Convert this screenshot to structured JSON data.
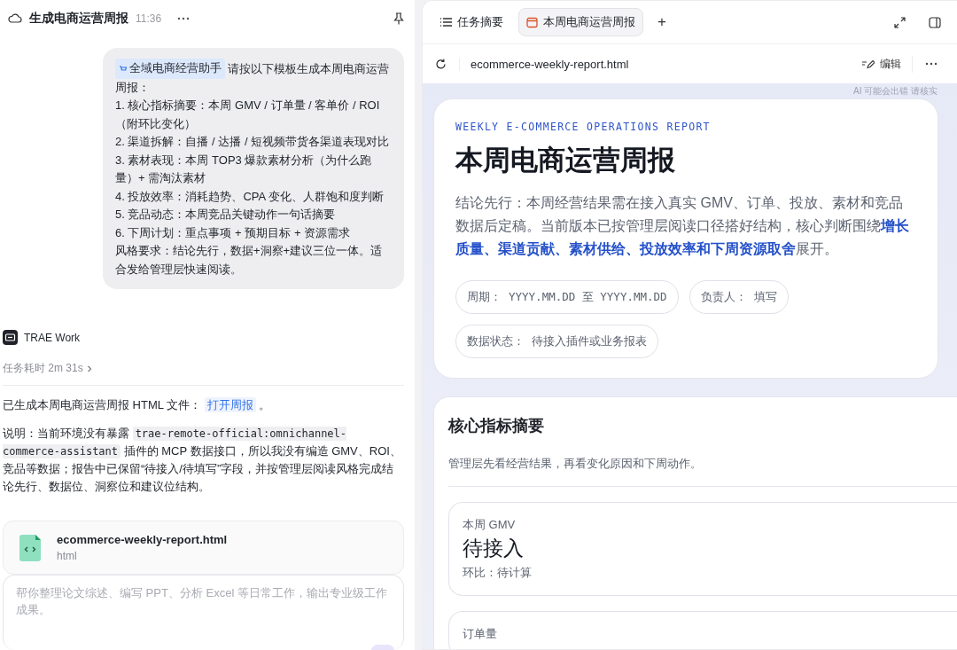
{
  "conversation": {
    "title": "生成电商运营周报",
    "time": "11:36"
  },
  "user_message": {
    "assistant_chip": "全域电商经营助手",
    "lines": [
      "请按以下模板生成本周电商运营周报：",
      "1. 核心指标摘要：本周 GMV / 订单量 / 客单价 / ROI（附环比变化）",
      "2. 渠道拆解：自播 / 达播 / 短视频带货各渠道表现对比",
      "3. 素材表现：本周 TOP3 爆款素材分析（为什么跑量）+ 需淘汰素材",
      "4. 投放效率：消耗趋势、CPA 变化、人群饱和度判断",
      "5. 竞品动态：本周竞品关键动作一句话摘要",
      "6. 下周计划：重点事项 + 预期目标 + 资源需求",
      "风格要求：结论先行，数据+洞察+建议三位一体。适合发给管理层快速阅读。"
    ]
  },
  "agent": {
    "name": "TRAE Work",
    "duration": "任务耗时 2m 31s"
  },
  "reply": {
    "generated_text": "已生成本周电商运营周报 HTML 文件：",
    "link": "打开周报",
    "generated_end": "。",
    "note_before": "说明：当前环境没有暴露 ",
    "note_code": "trae-remote-official:omnichannel-commerce-assistant",
    "note_after": " 插件的 MCP 数据接口，所以我没有编造 GMV、ROI、竞品等数据；报告中已保留“待接入/待填写”字段，并按管理层阅读风格完成结论先行、数据位、洞察位和建议位结构。"
  },
  "file_card": {
    "name": "ecommerce-weekly-report.html",
    "type": "html"
  },
  "composer": {
    "placeholder": "帮你整理论文综述、编写 PPT、分析 Excel 等日常工作，输出专业级工作成果。"
  },
  "tabs": [
    {
      "label": "任务摘要",
      "selected": false,
      "kind": "list"
    },
    {
      "label": "本周电商运营周报",
      "selected": true,
      "kind": "page"
    }
  ],
  "new_tab": "+",
  "address_bar": {
    "file": "ecommerce-weekly-report.html",
    "edit": "编辑"
  },
  "notice": "AI 可能会出错 请核实",
  "report": {
    "eyebrow": "WEEKLY E-COMMERCE OPERATIONS REPORT",
    "title": "本周电商运营周报",
    "summary": "结论先行：本周经营结果需在接入真实 GMV、订单、投放、素材和竞品数据后定稿。当前版本已按管理层阅读口径搭好结构，核心判断围绕**增长质量、渠道贡献、素材供给、投放效率和下周资源取舍**展开。",
    "meta": [
      {
        "label": "周期：",
        "value": "YYYY.MM.DD 至 YYYY.MM.DD",
        "kind": "mono"
      },
      {
        "label": "负责人：",
        "value": "填写",
        "kind": "text"
      },
      {
        "label": "数据状态：",
        "value": "待接入插件或业务报表",
        "kind": "text"
      }
    ]
  },
  "section": {
    "title": "核心指标摘要",
    "subtitle": "管理层先看经营结果，再看变化原因和下周动作。",
    "metrics": [
      {
        "label": "本周 GMV",
        "value": "待接入",
        "change": "环比：待计算"
      },
      {
        "label": "订单量"
      }
    ]
  }
}
